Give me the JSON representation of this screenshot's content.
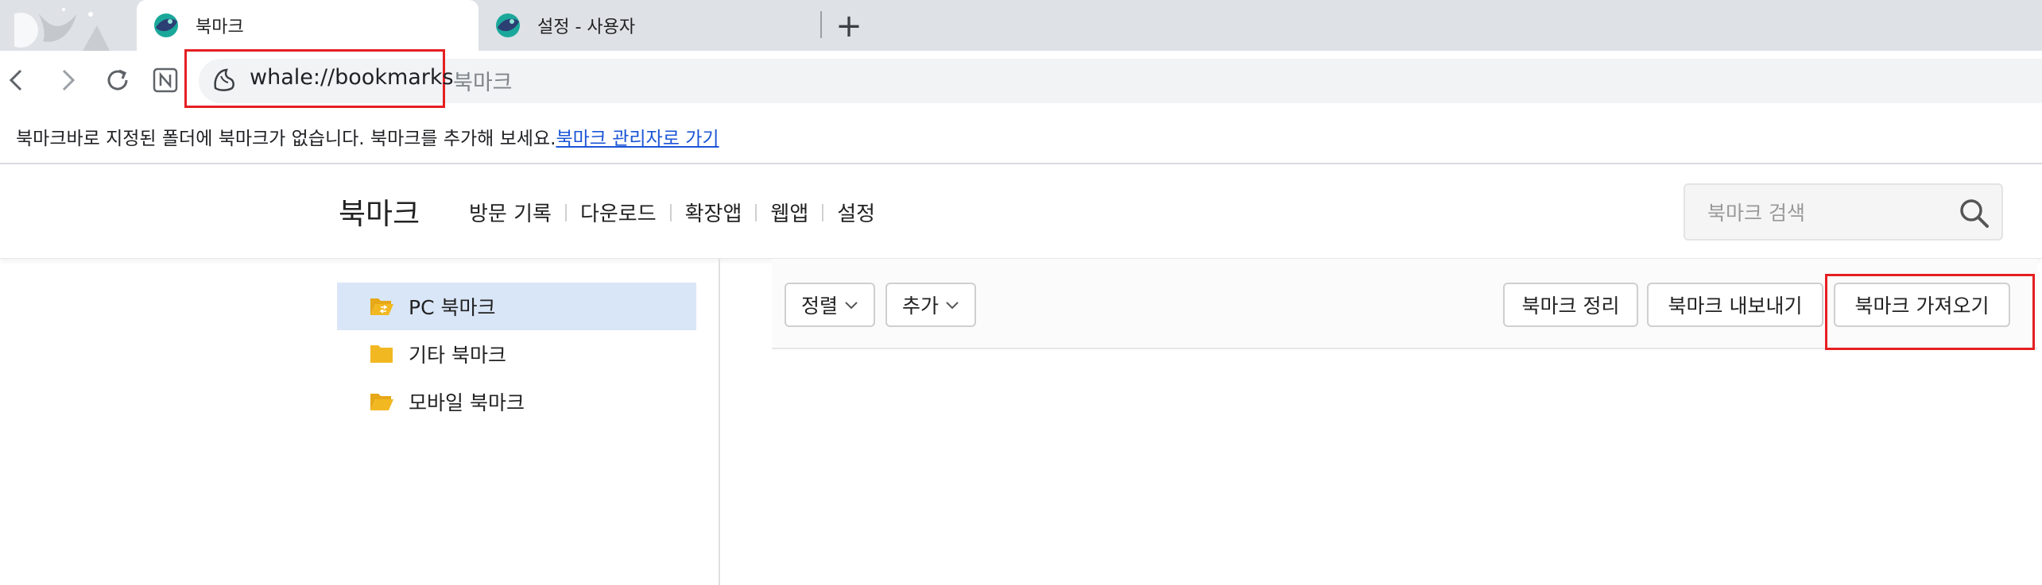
{
  "tabs": [
    {
      "title": "북마크",
      "active": true
    },
    {
      "title": "설정 - 사용자",
      "active": false
    }
  ],
  "toolbar": {
    "url": "whale://bookmarks",
    "page_title": "북마크"
  },
  "bookmark_bar": {
    "notice": "북마크바로 지정된 폴더에 북마크가 없습니다. 북마크를 추가해 보세요.",
    "link": "북마크 관리자로 가기"
  },
  "header": {
    "title": "북마크",
    "nav": [
      "방문 기록",
      "다운로드",
      "확장앱",
      "웹앱",
      "설정"
    ],
    "search_placeholder": "북마크 검색"
  },
  "folders": [
    {
      "label": "PC 북마크",
      "selected": true
    },
    {
      "label": "기타 북마크",
      "selected": false
    },
    {
      "label": "모바일 북마크",
      "selected": false
    }
  ],
  "actions": {
    "sort": "정렬",
    "add": "추가",
    "organize": "북마크 정리",
    "export": "북마크 내보내기",
    "import": "북마크 가져오기"
  },
  "colors": {
    "highlight_box": "#e51f22",
    "selected_folder_bg": "#d9e6f7",
    "folder_icon": "#f2b821",
    "link": "#1a55d6"
  }
}
